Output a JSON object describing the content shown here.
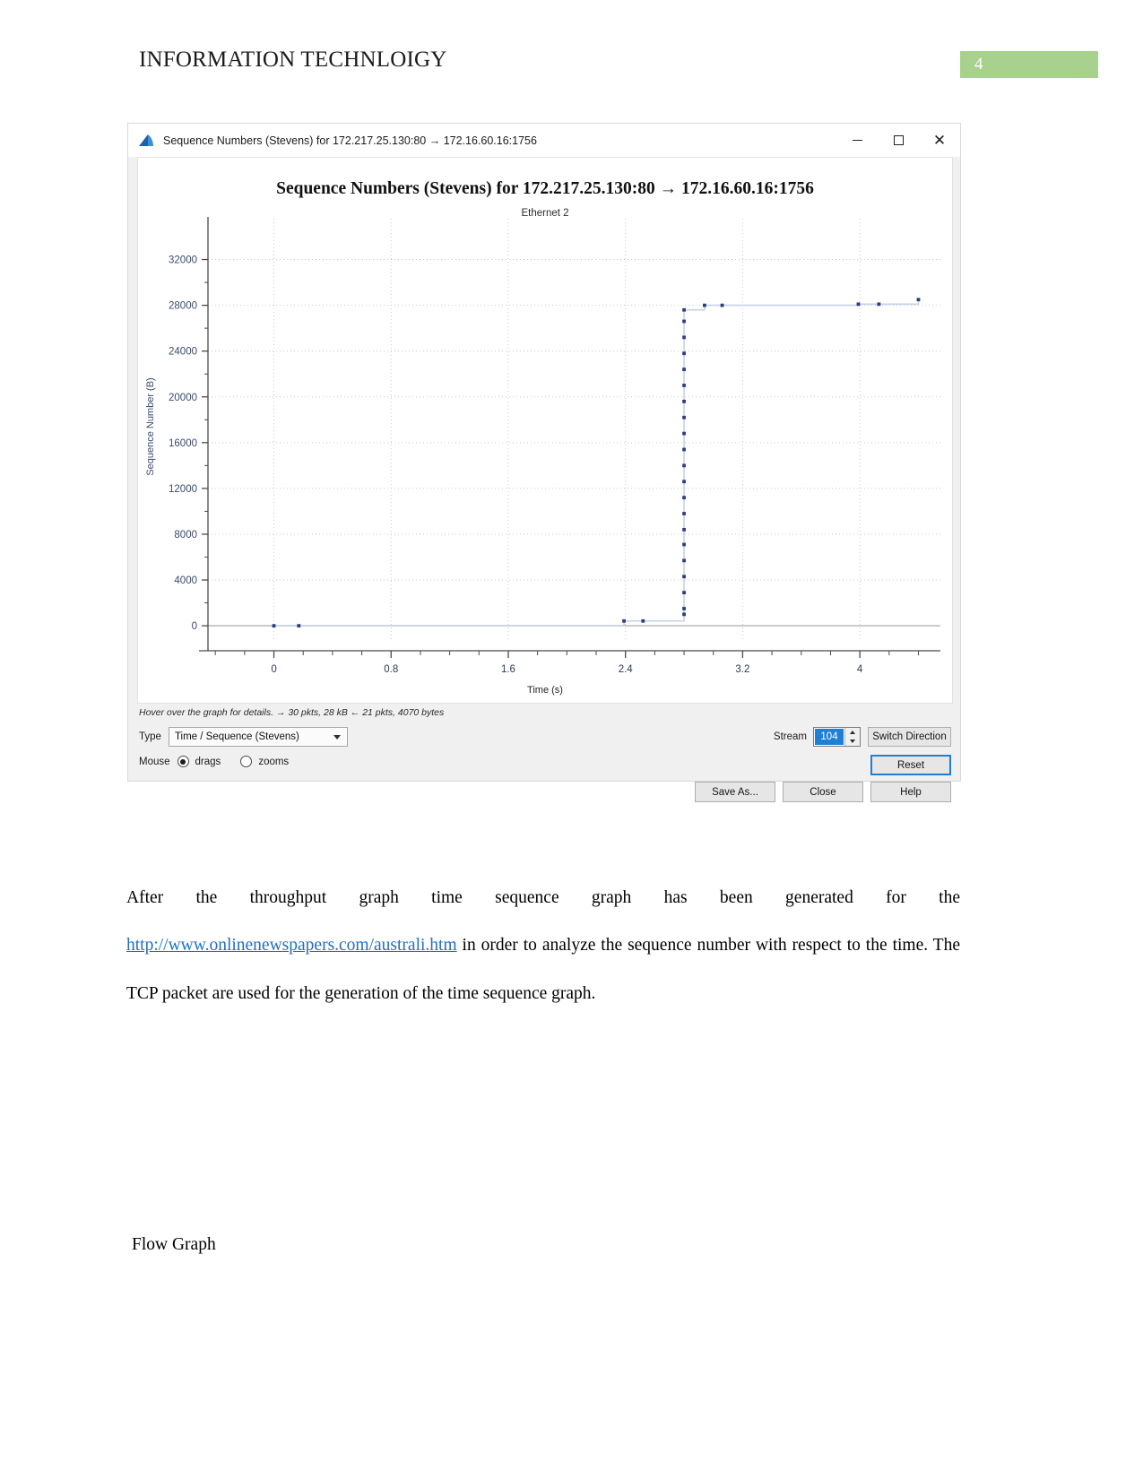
{
  "document": {
    "header_title": "INFORMATION TECHNLOIGY",
    "page_number": "4",
    "page_number_bg": "#a9d18e",
    "paragraph_before_link": "After the throughput graph time sequence graph has been generated for the ",
    "link_text": "http://www.onlinenewspapers.com/australi.htm",
    "paragraph_after_link": " in order to analyze the sequence number with respect to the time. The TCP packet are used for the generation of the time sequence graph.",
    "flow_graph_caption": "Flow Graph"
  },
  "window": {
    "title": "Sequence Numbers (Stevens) for 172.217.25.130:80 → 172.16.60.16:1756",
    "app_icon": "wireshark-fin-icon",
    "minimize_label": "—",
    "maximize_label": "□",
    "close_label": "✕"
  },
  "controls": {
    "hover_note": "Hover over the graph for details. → 30 pkts, 28 kB ← 21 pkts, 4070 bytes",
    "type_label": "Type",
    "type_value": "Time / Sequence (Stevens)",
    "mouse_label": "Mouse",
    "mouse_option_drags": "drags",
    "mouse_option_zooms": "zooms",
    "mouse_selected": "drags",
    "stream_label": "Stream",
    "stream_value": "104",
    "switch_direction_label": "Switch Direction",
    "reset_label": "Reset",
    "save_as_label": "Save As...",
    "close_label": "Close",
    "help_label": "Help",
    "focus_color": "#1f7fd4"
  },
  "chart_data": {
    "type": "scatter",
    "title": "Sequence Numbers (Stevens) for 172.217.25.130:80 → 172.16.60.16:1756",
    "subtitle": "Ethernet 2",
    "xlabel": "Time (s)",
    "ylabel": "Sequence Number (B)",
    "xlim": [
      -0.45,
      4.55
    ],
    "ylim": [
      -1400,
      34000
    ],
    "xticks": [
      0,
      0.8,
      1.6,
      2.4,
      3.2,
      4
    ],
    "xtick_labels": [
      "0",
      "0.8",
      "1.6",
      "2.4",
      "3.2",
      "4"
    ],
    "yticks": [
      0,
      4000,
      8000,
      12000,
      16000,
      20000,
      24000,
      28000,
      32000
    ],
    "ytick_labels": [
      "0",
      "4000",
      "8000",
      "12000",
      "16000",
      "20000",
      "24000",
      "28000",
      "32000"
    ],
    "grid": true,
    "legend": null,
    "marker_color": "#2a3f82",
    "line_color": "#c6d2e6",
    "points": [
      {
        "x": 0.0,
        "y": 0
      },
      {
        "x": 0.17,
        "y": 0
      },
      {
        "x": 2.39,
        "y": 420
      },
      {
        "x": 2.52,
        "y": 420
      },
      {
        "x": 2.8,
        "y": 1000
      },
      {
        "x": 2.8,
        "y": 1500
      },
      {
        "x": 2.8,
        "y": 2900
      },
      {
        "x": 2.8,
        "y": 4300
      },
      {
        "x": 2.8,
        "y": 5700
      },
      {
        "x": 2.8,
        "y": 7100
      },
      {
        "x": 2.8,
        "y": 8400
      },
      {
        "x": 2.8,
        "y": 9800
      },
      {
        "x": 2.8,
        "y": 11200
      },
      {
        "x": 2.8,
        "y": 12600
      },
      {
        "x": 2.8,
        "y": 14000
      },
      {
        "x": 2.8,
        "y": 15400
      },
      {
        "x": 2.8,
        "y": 16800
      },
      {
        "x": 2.8,
        "y": 18200
      },
      {
        "x": 2.8,
        "y": 19600
      },
      {
        "x": 2.8,
        "y": 21000
      },
      {
        "x": 2.8,
        "y": 22400
      },
      {
        "x": 2.8,
        "y": 23800
      },
      {
        "x": 2.8,
        "y": 25200
      },
      {
        "x": 2.8,
        "y": 26600
      },
      {
        "x": 2.8,
        "y": 27600
      },
      {
        "x": 2.94,
        "y": 28000
      },
      {
        "x": 3.06,
        "y": 28000
      },
      {
        "x": 3.99,
        "y": 28100
      },
      {
        "x": 4.13,
        "y": 28100
      },
      {
        "x": 4.4,
        "y": 28500
      }
    ]
  }
}
